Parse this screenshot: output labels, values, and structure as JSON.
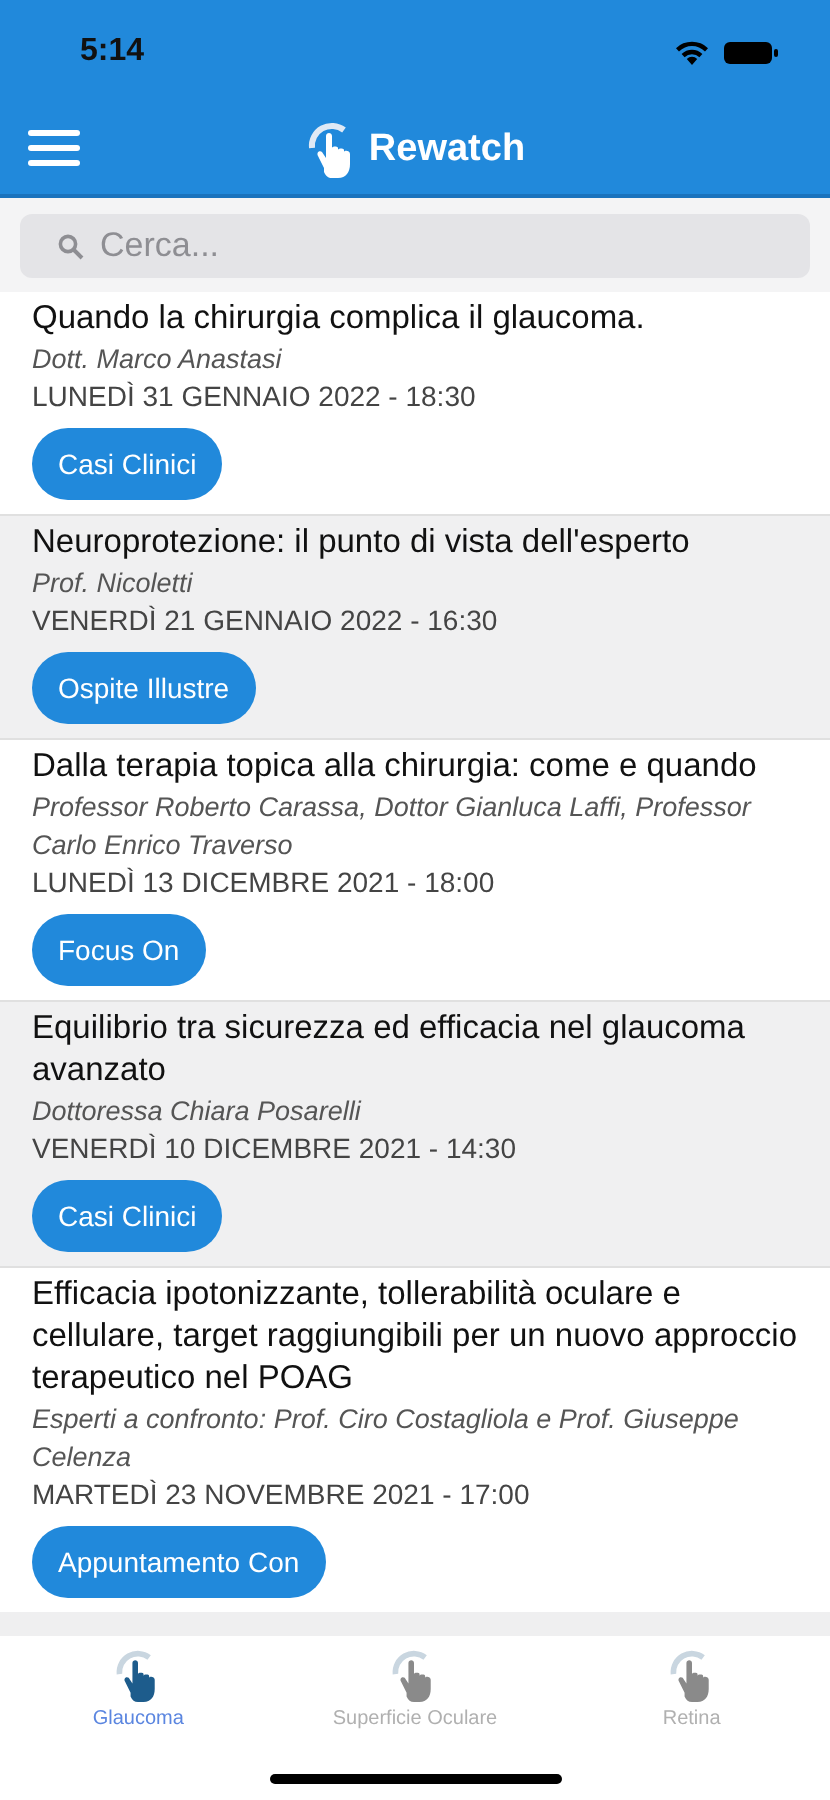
{
  "status_bar": {
    "time": "5:14"
  },
  "header": {
    "title": "Rewatch"
  },
  "search": {
    "placeholder": "Cerca..."
  },
  "events": [
    {
      "title": "Quando la chirurgia complica il glaucoma.",
      "speakers": "Dott. Marco Anastasi",
      "date": "LUNEDÌ 31 GENNAIO 2022 - 18:30",
      "category": "Casi Clinici"
    },
    {
      "title": "Neuroprotezione: il punto di vista dell'esperto",
      "speakers": "Prof. Nicoletti",
      "date": "VENERDÌ 21 GENNAIO 2022 - 16:30",
      "category": "Ospite Illustre"
    },
    {
      "title": "Dalla terapia topica alla chirurgia: come e quando",
      "speakers": "Professor Roberto Carassa, Dottor Gianluca Laffi, Professor Carlo Enrico Traverso",
      "date": "LUNEDÌ 13 DICEMBRE 2021 - 18:00",
      "category": "Focus On"
    },
    {
      "title": "Equilibrio tra sicurezza ed efficacia nel glaucoma avanzato",
      "speakers": "Dottoressa Chiara Posarelli",
      "date": "VENERDÌ 10 DICEMBRE 2021 - 14:30",
      "category": "Casi Clinici"
    },
    {
      "title": "Efficacia ipotonizzante, tollerabilità oculare e cellulare, target raggiungibili per un nuovo approccio terapeutico nel POAG",
      "speakers": "Esperti a confronto: Prof. Ciro Costagliola e Prof. Giuseppe Celenza",
      "date": "MARTEDÌ 23 NOVEMBRE 2021 - 17:00",
      "category": "Appuntamento Con"
    }
  ],
  "tab_bar": [
    {
      "label": "Glaucoma",
      "selected": true
    },
    {
      "label": "Superficie Oculare",
      "selected": false
    },
    {
      "label": "Retina",
      "selected": false
    }
  ]
}
